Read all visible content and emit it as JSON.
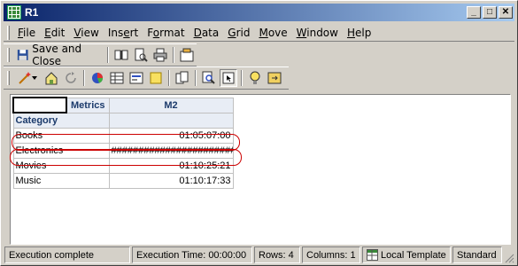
{
  "window": {
    "title": "R1"
  },
  "menu": [
    {
      "pre": "",
      "u": "F",
      "post": "ile"
    },
    {
      "pre": "",
      "u": "E",
      "post": "dit"
    },
    {
      "pre": "",
      "u": "V",
      "post": "iew"
    },
    {
      "pre": "Ins",
      "u": "e",
      "post": "rt"
    },
    {
      "pre": "F",
      "u": "o",
      "post": "rmat"
    },
    {
      "pre": "",
      "u": "D",
      "post": "ata"
    },
    {
      "pre": "",
      "u": "G",
      "post": "rid"
    },
    {
      "pre": "",
      "u": "M",
      "post": "ove"
    },
    {
      "pre": "",
      "u": "W",
      "post": "indow"
    },
    {
      "pre": "",
      "u": "H",
      "post": "elp"
    }
  ],
  "toolbar": {
    "save_close_label": "Save and Close"
  },
  "report": {
    "metrics_header": "Metrics",
    "column_header": "M2",
    "row_header": "Category",
    "rows": [
      {
        "category": "Books",
        "value": "01:05:07:00"
      },
      {
        "category": "Electronics",
        "value": "#######################"
      },
      {
        "category": "Movies",
        "value": "01:10:25:21"
      },
      {
        "category": "Music",
        "value": "01:10:17:33"
      }
    ]
  },
  "status": {
    "message": "Execution complete",
    "time": "Execution Time: 00:00:00",
    "rows": "Rows: 4",
    "columns": "Columns: 1",
    "template": "Local Template",
    "style": "Standard"
  },
  "colors": {
    "highlight": "#cc0000",
    "title_start": "#0a246a",
    "title_end": "#a6caf0",
    "header_text": "#1b3a6b"
  }
}
